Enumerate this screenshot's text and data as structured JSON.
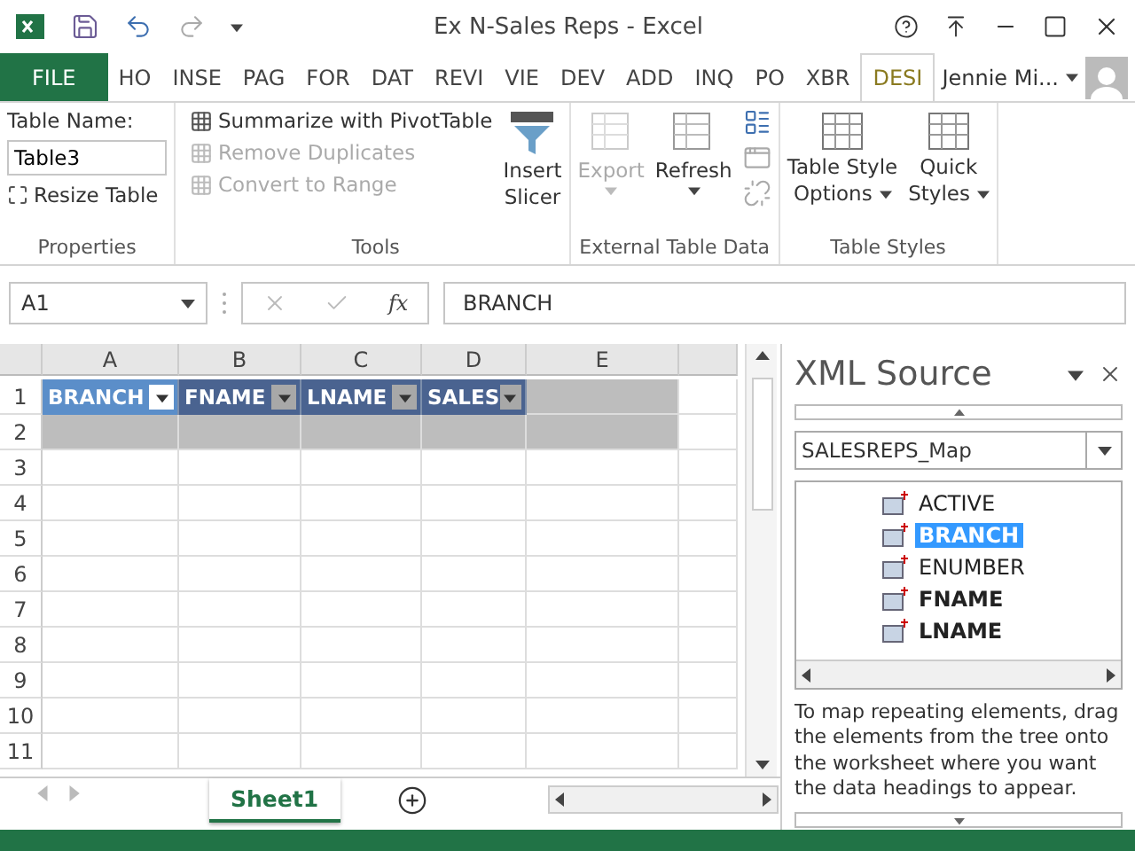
{
  "window": {
    "title": "Ex N-Sales Reps - Excel"
  },
  "ribbon_tabs": [
    {
      "label": "FILE",
      "kind": "file",
      "selected": false
    },
    {
      "label": "HO",
      "kind": "tab",
      "selected": false
    },
    {
      "label": "INSE",
      "kind": "tab",
      "selected": false
    },
    {
      "label": "PAG",
      "kind": "tab",
      "selected": false
    },
    {
      "label": "FOR",
      "kind": "tab",
      "selected": false
    },
    {
      "label": "DAT",
      "kind": "tab",
      "selected": false
    },
    {
      "label": "REVI",
      "kind": "tab",
      "selected": false
    },
    {
      "label": "VIE",
      "kind": "tab",
      "selected": false
    },
    {
      "label": "DEV",
      "kind": "tab",
      "selected": false
    },
    {
      "label": "ADD",
      "kind": "tab",
      "selected": false
    },
    {
      "label": "INQ",
      "kind": "tab",
      "selected": false
    },
    {
      "label": "PO",
      "kind": "tab",
      "selected": false
    },
    {
      "label": "XBR",
      "kind": "tab",
      "selected": false
    },
    {
      "label": "DESI",
      "kind": "tab",
      "selected": true
    }
  ],
  "user": {
    "name": "Jennie Mi..."
  },
  "ribbon": {
    "properties": {
      "table_name_label": "Table Name:",
      "table_name": "Table3",
      "resize": "Resize Table",
      "label": "Properties"
    },
    "tools": {
      "buttons": [
        {
          "label": "Summarize with PivotTable",
          "disabled": false
        },
        {
          "label": "Remove Duplicates",
          "disabled": true
        },
        {
          "label": "Convert to Range",
          "disabled": true
        }
      ],
      "slicer": [
        "Insert",
        "Slicer"
      ],
      "label": "Tools"
    },
    "external": {
      "buttons": [
        {
          "label": "Export",
          "disabled": true
        },
        {
          "label": "Refresh",
          "disabled": false
        }
      ],
      "label": "External Table Data"
    },
    "styles": {
      "options": [
        "Table Style",
        "Options"
      ],
      "quick": [
        "Quick",
        "Styles"
      ],
      "label": "Table Styles"
    }
  },
  "formula_bar": {
    "cell": "A1",
    "function_label": "fx",
    "formula": "BRANCH"
  },
  "sheet": {
    "columns": [
      "A",
      "B",
      "C",
      "D",
      "E"
    ],
    "rows": [
      "1",
      "2",
      "3",
      "4",
      "5",
      "6",
      "7",
      "8",
      "9",
      "10",
      "11"
    ],
    "table_headers": [
      {
        "label": "BRANCH",
        "selected": true
      },
      {
        "label": "FNAME",
        "selected": false
      },
      {
        "label": "LNAME",
        "selected": false
      },
      {
        "label": "SALES",
        "selected": false
      }
    ]
  },
  "sheet_tabs": [
    {
      "label": "Sheet1",
      "selected": true
    }
  ],
  "xml_source": {
    "title": "XML Source",
    "map": "SALESREPS_Map",
    "elements": [
      {
        "label": "ACTIVE",
        "mapped": false,
        "selected": false
      },
      {
        "label": "BRANCH",
        "mapped": true,
        "selected": true
      },
      {
        "label": "ENUMBER",
        "mapped": false,
        "selected": false
      },
      {
        "label": "FNAME",
        "mapped": true,
        "selected": false
      },
      {
        "label": "LNAME",
        "mapped": true,
        "selected": false
      }
    ],
    "help": "To map repeating elements, drag the elements from the tree onto the worksheet where you want the data headings to appear."
  }
}
